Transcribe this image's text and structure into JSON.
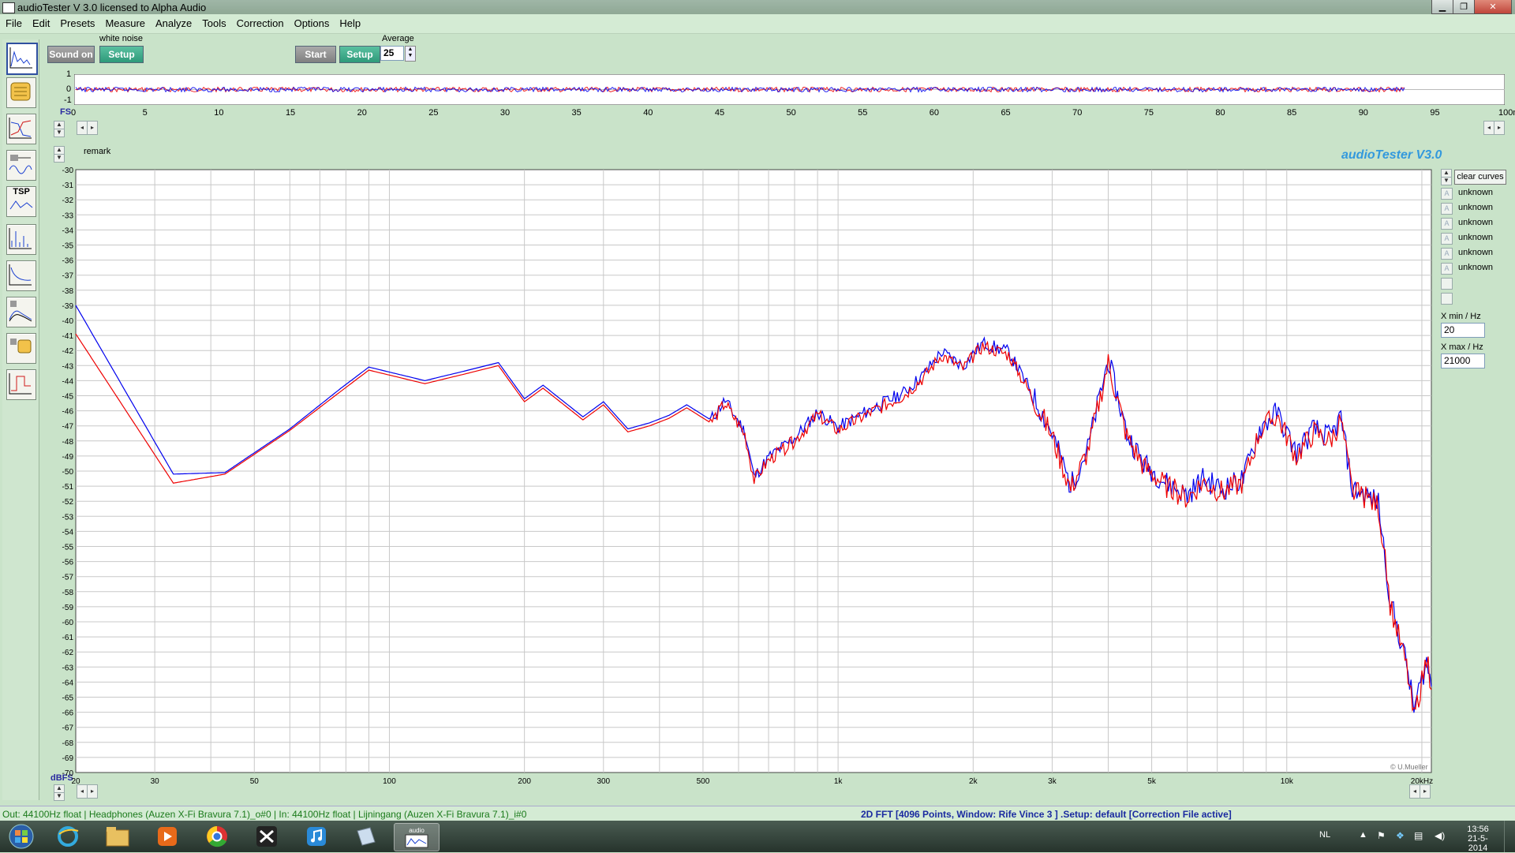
{
  "window": {
    "title": "audioTester  V 3.0   licensed to Alpha Audio"
  },
  "menu": [
    "File",
    "Edit",
    "Presets",
    "Measure",
    "Analyze",
    "Tools",
    "Correction",
    "Options",
    "Help"
  ],
  "toolbar": {
    "sound_button": "Sound on",
    "noise_label": "white noise",
    "setup_button": "Setup",
    "start_button": "Start",
    "setup2_button": "Setup",
    "average_label": "Average",
    "average_value": "25"
  },
  "left_tools": [
    {
      "name": "fft-analyzer-icon",
      "selected": true
    },
    {
      "name": "hands-icon"
    },
    {
      "name": "filter-response-icon"
    },
    {
      "name": "speaker-scope-icon"
    },
    {
      "name": "tsp-icon",
      "text": "TSP"
    },
    {
      "name": "spectrum-peaks-icon"
    },
    {
      "name": "bass-curve-icon"
    },
    {
      "name": "speaker-waterfall-icon"
    },
    {
      "name": "speaker-hands-icon"
    },
    {
      "name": "phase-icon"
    }
  ],
  "scope": {
    "fs_label": "FS",
    "y_ticks": [
      "1",
      "0",
      "-1"
    ],
    "x_ticks": [
      "0",
      "5",
      "10",
      "15",
      "20",
      "25",
      "30",
      "35",
      "40",
      "45",
      "50",
      "55",
      "60",
      "65",
      "70",
      "75",
      "80",
      "85",
      "90",
      "95",
      "100ms"
    ],
    "x_max_ms": 100,
    "signal_end_ms": 93
  },
  "remark_label": "remark",
  "watermark": "audioTester  V3.0",
  "copyright": "© U.Mueller",
  "side_panel": {
    "clear_curves": "clear curves",
    "curves": [
      "unknown",
      "unknown",
      "unknown",
      "unknown",
      "unknown",
      "unknown"
    ],
    "xmin_label": "X min / Hz",
    "xmin_value": "20",
    "xmax_label": "X max / Hz",
    "xmax_value": "21000"
  },
  "chart_data": {
    "type": "line",
    "xscale": "log",
    "xlim": [
      20,
      21000
    ],
    "ylim": [
      -70,
      -30
    ],
    "ylabel": "dBFS",
    "x_tick_labels": [
      {
        "v": 20,
        "t": "20"
      },
      {
        "v": 30,
        "t": "30"
      },
      {
        "v": 50,
        "t": "50"
      },
      {
        "v": 100,
        "t": "100"
      },
      {
        "v": 200,
        "t": "200"
      },
      {
        "v": 300,
        "t": "300"
      },
      {
        "v": 500,
        "t": "500"
      },
      {
        "v": 1000,
        "t": "1k"
      },
      {
        "v": 2000,
        "t": "2k"
      },
      {
        "v": 3000,
        "t": "3k"
      },
      {
        "v": 5000,
        "t": "5k"
      },
      {
        "v": 10000,
        "t": "10k"
      },
      {
        "v": 20000,
        "t": "20kHz"
      }
    ],
    "y_ticks": [
      -30,
      -31,
      -32,
      -33,
      -34,
      -35,
      -36,
      -37,
      -38,
      -39,
      -40,
      -41,
      -42,
      -43,
      -44,
      -45,
      -46,
      -47,
      -48,
      -49,
      -50,
      -51,
      -52,
      -53,
      -54,
      -55,
      -56,
      -57,
      -58,
      -59,
      -60,
      -61,
      -62,
      -63,
      -64,
      -65,
      -66,
      -67,
      -68,
      -69,
      -70
    ],
    "series": [
      {
        "color": "#0000ee",
        "points": [
          [
            20,
            -39.0
          ],
          [
            33,
            -50.2
          ],
          [
            43,
            -50.1
          ],
          [
            60,
            -47.2
          ],
          [
            78,
            -44.5
          ],
          [
            90,
            -43.1
          ],
          [
            120,
            -44.0
          ],
          [
            150,
            -43.3
          ],
          [
            175,
            -42.8
          ],
          [
            200,
            -45.2
          ],
          [
            220,
            -44.3
          ],
          [
            270,
            -46.4
          ],
          [
            300,
            -45.4
          ],
          [
            340,
            -47.2
          ],
          [
            380,
            -46.8
          ],
          [
            420,
            -46.3
          ],
          [
            460,
            -45.6
          ],
          [
            520,
            -46.6
          ],
          [
            560,
            -45.3
          ],
          [
            620,
            -47.4
          ],
          [
            650,
            -50.4
          ],
          [
            700,
            -49.1
          ],
          [
            800,
            -47.8
          ],
          [
            900,
            -46.1
          ],
          [
            1000,
            -47.1
          ],
          [
            1200,
            -45.8
          ],
          [
            1400,
            -44.8
          ],
          [
            1550,
            -43.6
          ],
          [
            1700,
            -42.1
          ],
          [
            1900,
            -43.0
          ],
          [
            2100,
            -41.5
          ],
          [
            2400,
            -42.1
          ],
          [
            2700,
            -44.8
          ],
          [
            3000,
            -47.5
          ],
          [
            3300,
            -51.0
          ],
          [
            3600,
            -48.5
          ],
          [
            4000,
            -42.6
          ],
          [
            4400,
            -47.5
          ],
          [
            4800,
            -49.5
          ],
          [
            5400,
            -50.8
          ],
          [
            6000,
            -51.6
          ],
          [
            6500,
            -50.5
          ],
          [
            7200,
            -51.2
          ],
          [
            8000,
            -50.5
          ],
          [
            8700,
            -47.2
          ],
          [
            9500,
            -46.1
          ],
          [
            10500,
            -48.8
          ],
          [
            11500,
            -47.2
          ],
          [
            12500,
            -47.8
          ],
          [
            13200,
            -46.4
          ],
          [
            14000,
            -51.2
          ],
          [
            15000,
            -51.6
          ],
          [
            16000,
            -52.1
          ],
          [
            17000,
            -58.6
          ],
          [
            18500,
            -62.8
          ],
          [
            19200,
            -65.8
          ],
          [
            20500,
            -62.6
          ],
          [
            21000,
            -64.3
          ]
        ]
      },
      {
        "color": "#ee0000",
        "points": [
          [
            20,
            -40.9
          ],
          [
            33,
            -50.8
          ],
          [
            43,
            -50.2
          ],
          [
            60,
            -47.3
          ],
          [
            78,
            -44.7
          ],
          [
            90,
            -43.3
          ],
          [
            120,
            -44.2
          ],
          [
            150,
            -43.5
          ],
          [
            175,
            -43.0
          ],
          [
            200,
            -45.4
          ],
          [
            220,
            -44.5
          ],
          [
            270,
            -46.6
          ],
          [
            300,
            -45.6
          ],
          [
            340,
            -47.4
          ],
          [
            380,
            -47.0
          ],
          [
            420,
            -46.5
          ],
          [
            460,
            -45.8
          ],
          [
            520,
            -46.8
          ],
          [
            560,
            -45.5
          ],
          [
            620,
            -47.6
          ],
          [
            650,
            -50.6
          ],
          [
            700,
            -49.3
          ],
          [
            800,
            -48.0
          ],
          [
            900,
            -46.3
          ],
          [
            1000,
            -47.3
          ],
          [
            1200,
            -46.0
          ],
          [
            1400,
            -45.0
          ],
          [
            1550,
            -43.8
          ],
          [
            1700,
            -42.3
          ],
          [
            1900,
            -43.2
          ],
          [
            2100,
            -41.7
          ],
          [
            2400,
            -42.3
          ],
          [
            2700,
            -45.0
          ],
          [
            3000,
            -47.7
          ],
          [
            3300,
            -51.2
          ],
          [
            3600,
            -48.7
          ],
          [
            4000,
            -42.8
          ],
          [
            4400,
            -47.7
          ],
          [
            4800,
            -49.7
          ],
          [
            5400,
            -51.0
          ],
          [
            6000,
            -51.8
          ],
          [
            6500,
            -50.7
          ],
          [
            7200,
            -51.4
          ],
          [
            8000,
            -50.7
          ],
          [
            8700,
            -47.4
          ],
          [
            9500,
            -46.3
          ],
          [
            10500,
            -49.0
          ],
          [
            11500,
            -47.4
          ],
          [
            12500,
            -48.0
          ],
          [
            13200,
            -46.6
          ],
          [
            14000,
            -51.4
          ],
          [
            15000,
            -51.8
          ],
          [
            16000,
            -52.3
          ],
          [
            17000,
            -58.8
          ],
          [
            18500,
            -63.0
          ],
          [
            19200,
            -66.4
          ],
          [
            20500,
            -62.4
          ],
          [
            21000,
            -64.5
          ]
        ]
      }
    ]
  },
  "status": {
    "left": "Out: 44100Hz float  | Headphones (Auzen X-Fi Bravura 7.1)_o#0  | In: 44100Hz float  | Lijningang (Auzen X-Fi Bravura 7.1)_i#0",
    "center": "2D FFT [4096 Points, Window: Rife Vince 3 ]  .Setup:  default  [Correction File active]"
  },
  "taskbar": {
    "clock_time": "13:56",
    "clock_date": "21-5-2014",
    "lang": "NL",
    "apps": [
      "windows-start-icon",
      "internet-explorer-icon",
      "file-explorer-icon",
      "media-player-icon",
      "chrome-icon",
      "crossover-icon",
      "itunes-icon",
      "window-app-icon",
      "audiotester-icon"
    ],
    "active_app_label": "audio"
  },
  "colors": {
    "panel": "#c9e3c9",
    "plot_bg": "#ffffff",
    "grid": "#c8c8c8",
    "curve1": "#0000ee",
    "curve2": "#ee0000",
    "title_blue": "#3399dd"
  }
}
